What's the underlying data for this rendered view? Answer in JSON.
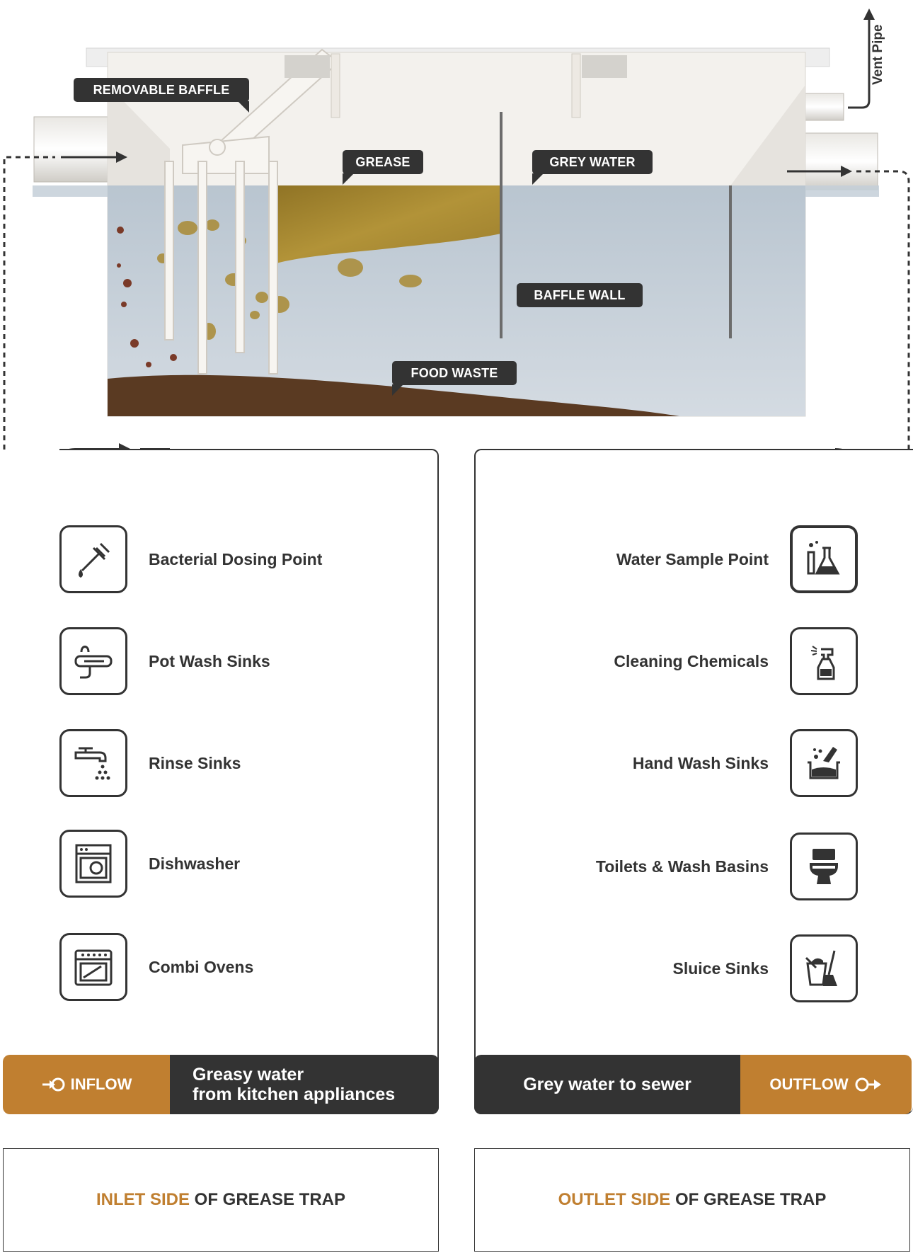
{
  "colors": {
    "accent": "#c07f30",
    "dark": "#333333",
    "water": "#c9d3dc",
    "grease": "#a8852c",
    "food_waste": "#5c3a24",
    "tank": "#f2f0ec"
  },
  "tank": {
    "vent_label": "Vent Pipe",
    "callouts": {
      "removable_baffle": "REMOVABLE BAFFLE",
      "grease": "GREASE",
      "grey_water": "GREY WATER",
      "baffle_wall": "BAFFLE WALL",
      "food_waste": "FOOD WASTE"
    }
  },
  "inlet_side": {
    "items": [
      {
        "label": "Bacterial Dosing Point",
        "icon": "dropper-icon"
      },
      {
        "label": "Pot Wash Sinks",
        "icon": "pot-wash-sink-icon"
      },
      {
        "label": "Rinse Sinks",
        "icon": "faucet-icon"
      },
      {
        "label": "Dishwasher",
        "icon": "dishwasher-icon"
      },
      {
        "label": "Combi Ovens",
        "icon": "oven-icon"
      }
    ],
    "banner": {
      "tag": "INFLOW",
      "icon": "inflow-icon",
      "line1": "Greasy water",
      "line2": "from kitchen appliances"
    },
    "footer": {
      "highlight": "INLET SIDE",
      "rest": " OF GREASE TRAP"
    }
  },
  "outlet_side": {
    "items": [
      {
        "label": "Water Sample Point",
        "icon": "flask-icon"
      },
      {
        "label": "Cleaning Chemicals",
        "icon": "spray-bottle-icon"
      },
      {
        "label": "Hand Wash Sinks",
        "icon": "hand-wash-icon"
      },
      {
        "label": "Toilets & Wash Basins",
        "icon": "toilet-icon"
      },
      {
        "label": "Sluice Sinks",
        "icon": "sluice-bucket-icon"
      }
    ],
    "banner": {
      "tag": "OUTFLOW",
      "icon": "outflow-icon",
      "text": "Grey water to sewer"
    },
    "footer": {
      "highlight": "OUTLET SIDE",
      "rest": " OF GREASE TRAP"
    }
  }
}
